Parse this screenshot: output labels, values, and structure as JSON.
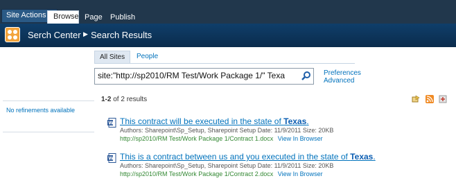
{
  "ribbon": {
    "site_actions": "Site Actions",
    "tabs": [
      "Browse",
      "Page",
      "Publish"
    ]
  },
  "header": {
    "breadcrumb": [
      "Serch Center",
      "Search Results"
    ]
  },
  "scopes": [
    "All Sites",
    "People"
  ],
  "search": {
    "value": "site:\"http://sp2010/RM Test/Work Package 1/\" Texa"
  },
  "links": {
    "preferences": "Preferences",
    "advanced": "Advanced"
  },
  "refinement": {
    "empty_text": "No refinements available"
  },
  "results_summary": {
    "range": "1-2",
    "of_text": "of 2 results"
  },
  "results": [
    {
      "title_pre": "This contract will be executed in the state of ",
      "title_hit": "Texas",
      "title_post": ".",
      "meta": "Authors: Sharepoint\\Sp_Setup, Sharepoint Setup   Date: 11/9/2011   Size: 20KB",
      "url": "http://sp2010/RM Test/Work Package 1/Contract 1.docx",
      "view_in_browser": "View In Browser"
    },
    {
      "title_pre": "This is a contract between us and you executed in the state of ",
      "title_hit": "Texas",
      "title_post": ".",
      "meta": "Authors: Sharepoint\\Sp_Setup, Sharepoint Setup   Date: 11/9/2011   Size: 20KB",
      "url": "http://sp2010/RM Test/Work Package 1/Contract 2.docx",
      "view_in_browser": "View In Browser"
    }
  ],
  "colors": {
    "ribbon_bg": "#21374c",
    "titlebar_bg": "#0f3e6a",
    "link": "#0072bc",
    "url_green": "#338833"
  },
  "icons": [
    "site-logo-icon",
    "breadcrumb-arrow-icon",
    "search-icon",
    "alert-icon",
    "rss-icon",
    "more-icon",
    "word-doc-icon"
  ]
}
